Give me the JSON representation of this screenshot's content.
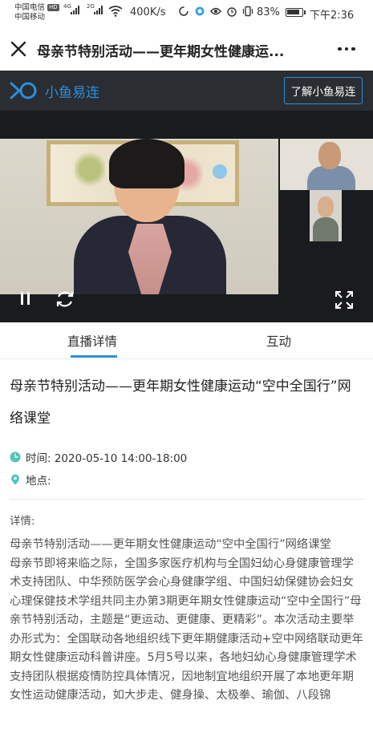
{
  "status_bar": {
    "carrier1": "中国电信",
    "hd_badge": "HD",
    "carrier2": "中国移动",
    "net1": "4G",
    "net2": "2G",
    "speed": "400K/s",
    "battery": "83%",
    "time": "下午2:36"
  },
  "titlebar": {
    "title": "母亲节特别活动——更年期女性健康运..."
  },
  "banner": {
    "brand": "小鱼易连",
    "learn_more": "了解小鱼易连"
  },
  "tabs": {
    "detail": "直播详情",
    "interact": "互动"
  },
  "event": {
    "title": "母亲节特别活动——更年期女性健康运动“空中全国行”网络课堂",
    "time": "时间: 2020-05-10 14:00-18:00",
    "location": "地点:",
    "detail_label": "详情:",
    "paragraph1": "母亲节特别活动——更年期女性健康运动“空中全国行”网络课堂",
    "paragraph2": "母亲节即将来临之际，全国多家医疗机构与全国妇幼心身健康管理学术支持团队、中华预防医学会心身健康学组、中国妇幼保健协会妇女心理保健技术学组共同主办第3期更年期女性健康运动“空中全国行”母亲节特别活动，主题是“更运动、更健康、更精彩”。本次活动主要举办形式为：全国联动各地组织线下更年期健康活动+空中网络联动更年期女性健康运动科普讲座。5月5号以来，各地妇幼心身健康管理学术支持团队根据疫情防控具体情况，因地制宜地组织开展了本地更年期女性运动健康活动，如大步走、健身操、太极拳、瑜伽、八段锦"
  },
  "colors": {
    "accent": "#2c8fdc",
    "banner_bg": "#2a2d32",
    "meta_icon": "#52c7b8"
  }
}
